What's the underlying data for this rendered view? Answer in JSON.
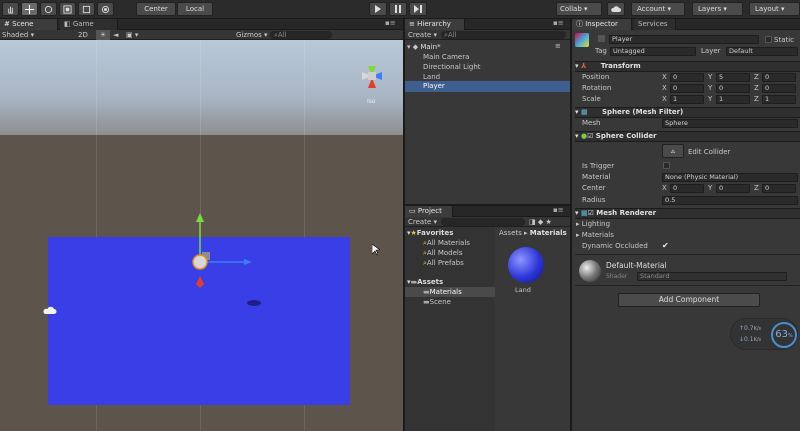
{
  "toolbar": {
    "pivot": "Center",
    "space": "Local",
    "collab": "Collab",
    "account": "Account",
    "layers": "Layers",
    "layout": "Layout"
  },
  "scene": {
    "tab_scene": "Scene",
    "tab_game": "Game",
    "shading": "Shaded",
    "mode_2d": "2D",
    "gizmos": "Gizmos",
    "search_placeholder": "All",
    "persp_label": "Iso",
    "colors": {
      "sky_top": "#b4c4d6",
      "ground": "#5e554c",
      "plane": "#3a3ee6"
    }
  },
  "hierarchy": {
    "tab": "Hierarchy",
    "create": "Create",
    "search_placeholder": "All",
    "scene_name": "Main*",
    "items": [
      "Main Camera",
      "Directional Light",
      "Land",
      "Player"
    ],
    "selected": "Player"
  },
  "project": {
    "tab": "Project",
    "create": "Create",
    "favorites_label": "Favorites",
    "favorites": [
      "All Materials",
      "All Models",
      "All Prefabs"
    ],
    "assets_label": "Assets",
    "assets_children": [
      "Materials",
      "Scene"
    ],
    "breadcrumb_root": "Assets",
    "breadcrumb_sep": "▸",
    "breadcrumb_current": "Materials",
    "asset_name": "Land"
  },
  "inspector": {
    "tab_inspector": "Inspector",
    "tab_services": "Services",
    "object_name": "Player",
    "static_label": "Static",
    "tag_label": "Tag",
    "tag_value": "Untagged",
    "layer_label": "Layer",
    "layer_value": "Default",
    "transform": {
      "title": "Transform",
      "position_label": "Position",
      "rotation_label": "Rotation",
      "scale_label": "Scale",
      "position": [
        "0",
        "5",
        "0"
      ],
      "rotation": [
        "0",
        "0",
        "0"
      ],
      "scale": [
        "1",
        "1",
        "1"
      ]
    },
    "mesh_filter": {
      "title": "Sphere (Mesh Filter)",
      "mesh_label": "Mesh",
      "mesh_value": "Sphere"
    },
    "collider": {
      "title": "Sphere Collider",
      "edit_label": "Edit Collider",
      "is_trigger_label": "Is Trigger",
      "material_label": "Material",
      "material_value": "None (Physic Material)",
      "center_label": "Center",
      "center": [
        "0",
        "0",
        "0"
      ],
      "radius_label": "Radius",
      "radius_value": "0.5"
    },
    "renderer": {
      "title": "Mesh Renderer",
      "lighting_label": "Lighting",
      "materials_label": "Materials",
      "dynamic_label": "Dynamic Occluded"
    },
    "material": {
      "name": "Default-Material",
      "shader_label": "Shader",
      "shader_value": "Standard"
    },
    "add_component": "Add Component",
    "stats": {
      "rate_up": "0.7",
      "rate_down": "0.1",
      "unit": "K/s",
      "percent": "63",
      "percent_sign": "%"
    }
  },
  "axes": {
    "x": "X",
    "y": "Y",
    "z": "Z"
  }
}
